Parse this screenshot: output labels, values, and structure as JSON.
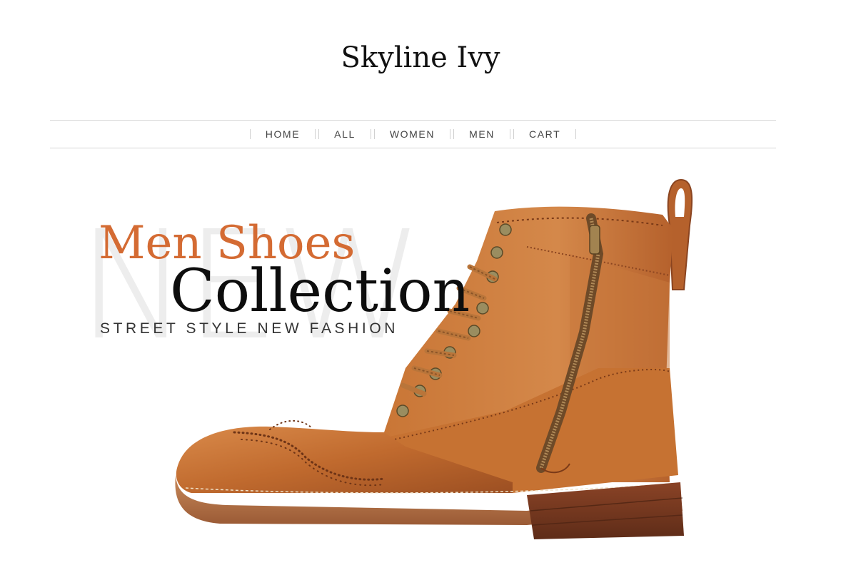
{
  "site": {
    "title": "Skyline Ivy"
  },
  "nav": {
    "items": [
      {
        "label": "HOME"
      },
      {
        "label": "ALL"
      },
      {
        "label": "WOMEN"
      },
      {
        "label": "MEN"
      },
      {
        "label": "CART"
      }
    ]
  },
  "hero": {
    "watermark": "NEW",
    "line1": "Men Shoes",
    "line2": "Collection",
    "line3": "STREET STYLE NEW FASHION",
    "image_subject": "brown leather wingtip brogue boot with side zipper",
    "colors": {
      "accent": "#d46b33",
      "leather": "#c06a2e",
      "sole": "#8a4a2c"
    }
  }
}
